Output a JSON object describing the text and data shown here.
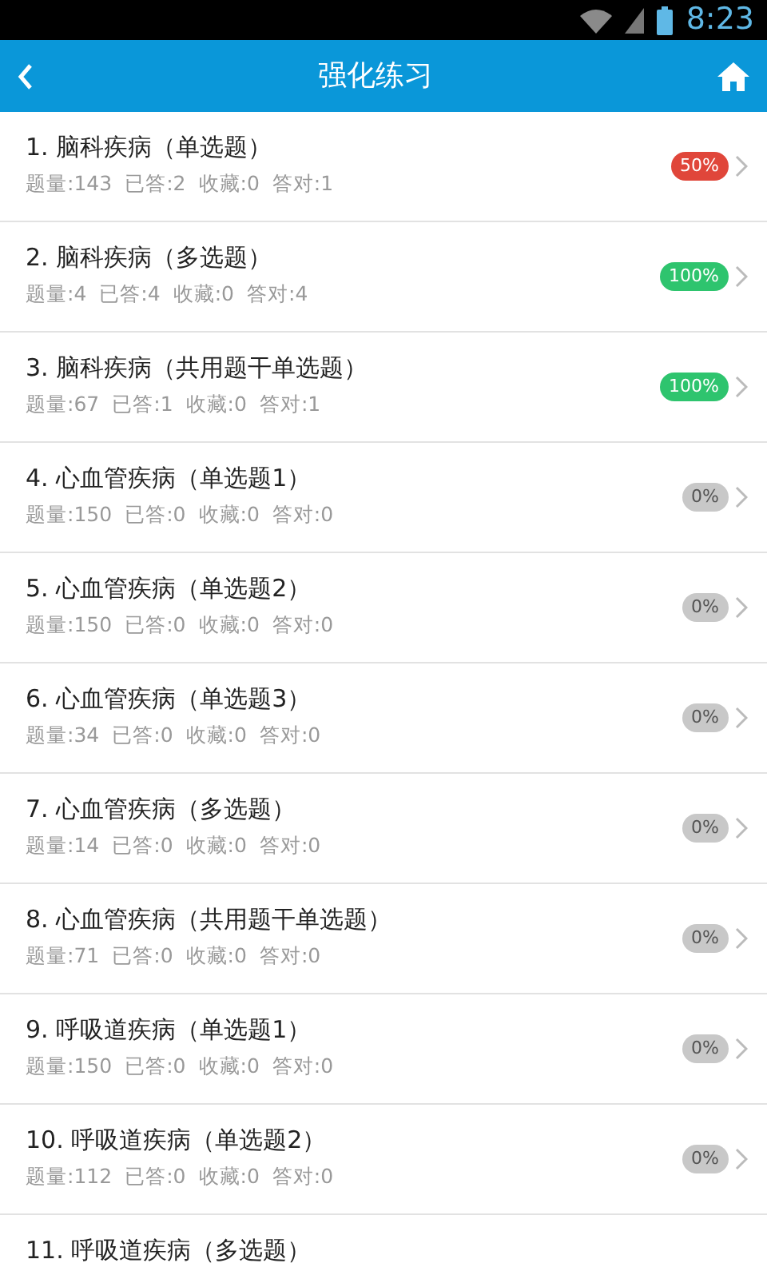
{
  "status_bar": {
    "time": "8:23"
  },
  "header": {
    "title": "强化练习"
  },
  "items": [
    {
      "title": "1. 脑科疾病（单选题）",
      "stats": [
        "题量:143",
        "已答:2",
        "收藏:0",
        "答对:1"
      ],
      "percent": "50%",
      "color": "#e0463a"
    },
    {
      "title": "2. 脑科疾病（多选题）",
      "stats": [
        "题量:4",
        "已答:4",
        "收藏:0",
        "答对:4"
      ],
      "percent": "100%",
      "color": "#2ec46e"
    },
    {
      "title": "3. 脑科疾病（共用题干单选题）",
      "stats": [
        "题量:67",
        "已答:1",
        "收藏:0",
        "答对:1"
      ],
      "percent": "100%",
      "color": "#2ec46e"
    },
    {
      "title": "4. 心血管疾病（单选题1）",
      "stats": [
        "题量:150",
        "已答:0",
        "收藏:0",
        "答对:0"
      ],
      "percent": "0%",
      "color": "#c8c8c8"
    },
    {
      "title": "5. 心血管疾病（单选题2）",
      "stats": [
        "题量:150",
        "已答:0",
        "收藏:0",
        "答对:0"
      ],
      "percent": "0%",
      "color": "#c8c8c8"
    },
    {
      "title": "6. 心血管疾病（单选题3）",
      "stats": [
        "题量:34",
        "已答:0",
        "收藏:0",
        "答对:0"
      ],
      "percent": "0%",
      "color": "#c8c8c8"
    },
    {
      "title": "7. 心血管疾病（多选题）",
      "stats": [
        "题量:14",
        "已答:0",
        "收藏:0",
        "答对:0"
      ],
      "percent": "0%",
      "color": "#c8c8c8"
    },
    {
      "title": "8. 心血管疾病（共用题干单选题）",
      "stats": [
        "题量:71",
        "已答:0",
        "收藏:0",
        "答对:0"
      ],
      "percent": "0%",
      "color": "#c8c8c8"
    },
    {
      "title": "9. 呼吸道疾病（单选题1）",
      "stats": [
        "题量:150",
        "已答:0",
        "收藏:0",
        "答对:0"
      ],
      "percent": "0%",
      "color": "#c8c8c8"
    },
    {
      "title": "10. 呼吸道疾病（单选题2）",
      "stats": [
        "题量:112",
        "已答:0",
        "收藏:0",
        "答对:0"
      ],
      "percent": "0%",
      "color": "#c8c8c8"
    },
    {
      "title": "11. 呼吸道疾病（多选题）"
    }
  ]
}
